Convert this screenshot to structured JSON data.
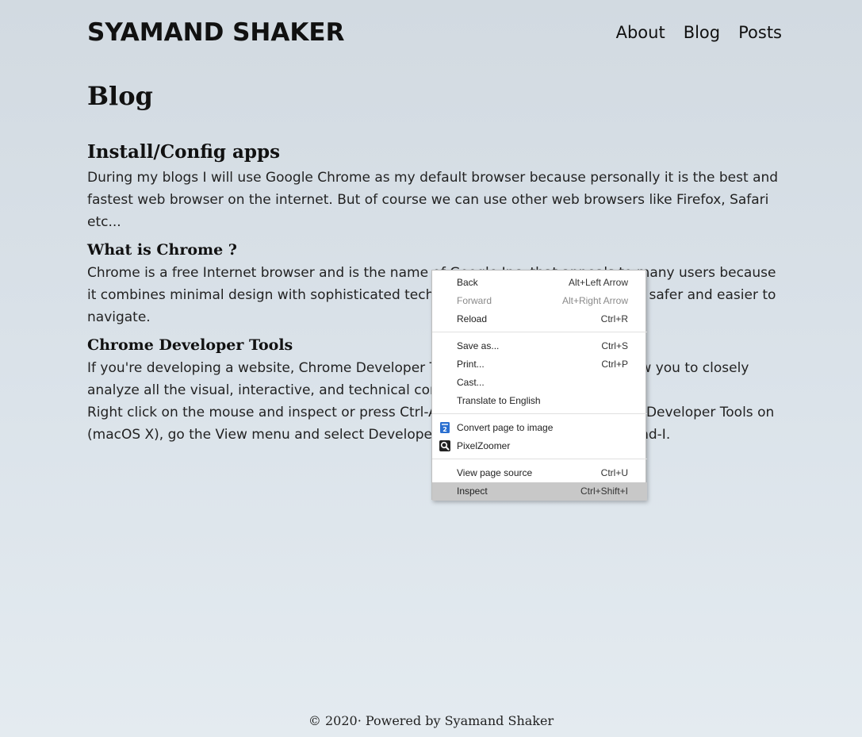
{
  "site": {
    "title": "SYAMAND SHAKER",
    "nav": {
      "about": "About",
      "blog": "Blog",
      "posts": "Posts"
    }
  },
  "page": {
    "title": "Blog",
    "sections": {
      "install": {
        "heading": "Install/Config apps",
        "text": "During my blogs I will use Google Chrome as my default browser because personally it is the best and fastest web browser on the internet. But of course we can use other web browsers like Firefox, Safari etc..."
      },
      "what_is_chrome": {
        "heading": "What is Chrome ?",
        "text": "Chrome is a free Internet browser and is the name of Google Inc. that appeals to many users because it combines minimal design with sophisticated technology to make the web faster, safer and easier to navigate."
      },
      "devtools": {
        "heading": "Chrome Developer Tools",
        "text1": "If you're developing a website, Chrome Developer Tools are a set of tools that allow you to closely analyze all the visual, interactive, and technical components of a web page.",
        "text2": "Right click on the mouse and inspect or press Ctrl-Alt-I or F12 to open the Chrome Developer Tools on (macOS X), go the View menu and select Developer Tools or press Option-Command-I."
      }
    }
  },
  "footer": {
    "text": "© 2020· Powered by Syamand Shaker"
  },
  "context_menu": {
    "items": {
      "back": {
        "label": "Back",
        "shortcut": "Alt+Left Arrow"
      },
      "forward": {
        "label": "Forward",
        "shortcut": "Alt+Right Arrow",
        "disabled": true
      },
      "reload": {
        "label": "Reload",
        "shortcut": "Ctrl+R"
      },
      "save_as": {
        "label": "Save as...",
        "shortcut": "Ctrl+S"
      },
      "print": {
        "label": "Print...",
        "shortcut": "Ctrl+P"
      },
      "cast": {
        "label": "Cast..."
      },
      "translate": {
        "label": "Translate to English"
      },
      "convert": {
        "label": "Convert page to image",
        "icon": "convert-page-extension-icon"
      },
      "pixelzoomer": {
        "label": "PixelZoomer",
        "icon": "pixelzoomer-magnifier-icon"
      },
      "view_source": {
        "label": "View page source",
        "shortcut": "Ctrl+U"
      },
      "inspect": {
        "label": "Inspect",
        "shortcut": "Ctrl+Shift+I",
        "highlighted": true
      }
    },
    "colors": {
      "highlight": "#c8c8c8",
      "disabled_text": "#8a8a8a",
      "convert_icon_bg": "#2a6fd0"
    }
  }
}
